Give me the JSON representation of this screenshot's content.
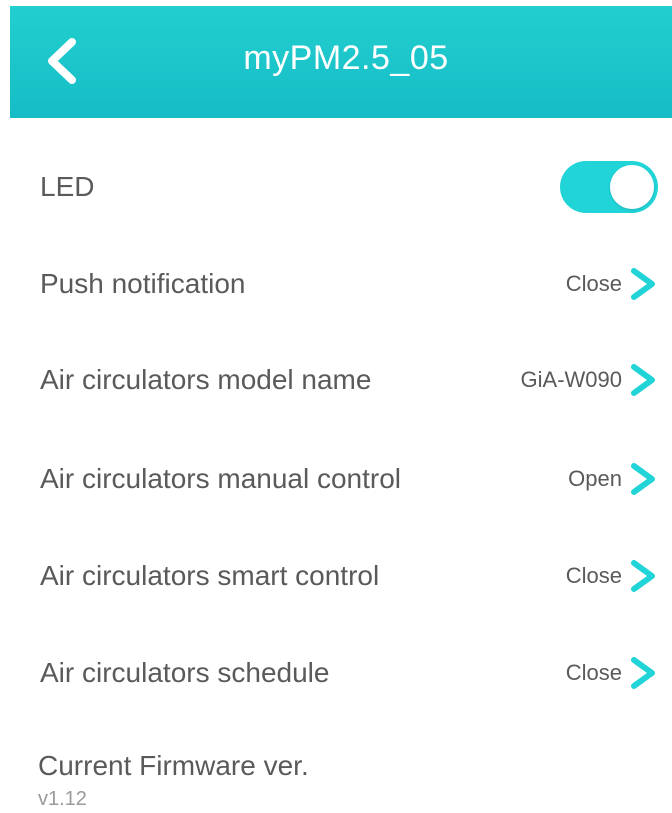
{
  "header": {
    "title": "myPM2.5_05",
    "back_icon": "chevron-left-icon"
  },
  "colors": {
    "header_bg": "#1ec6c9",
    "accent": "#21d4d8",
    "label_text": "#5a5a5a",
    "muted_text": "#9a9a9a"
  },
  "settings": {
    "led": {
      "label": "LED",
      "toggle_on": true
    },
    "push_notification": {
      "label": "Push notification",
      "value": "Close"
    },
    "model_name": {
      "label": "Air circulators model name",
      "value": "GiA-W090"
    },
    "manual_control": {
      "label": "Air circulators manual control",
      "value": "Open"
    },
    "smart_control": {
      "label": "Air circulators smart control",
      "value": "Close"
    },
    "schedule": {
      "label": "Air circulators schedule",
      "value": "Close"
    }
  },
  "firmware": {
    "label": "Current Firmware ver.",
    "version": "v1.12"
  }
}
